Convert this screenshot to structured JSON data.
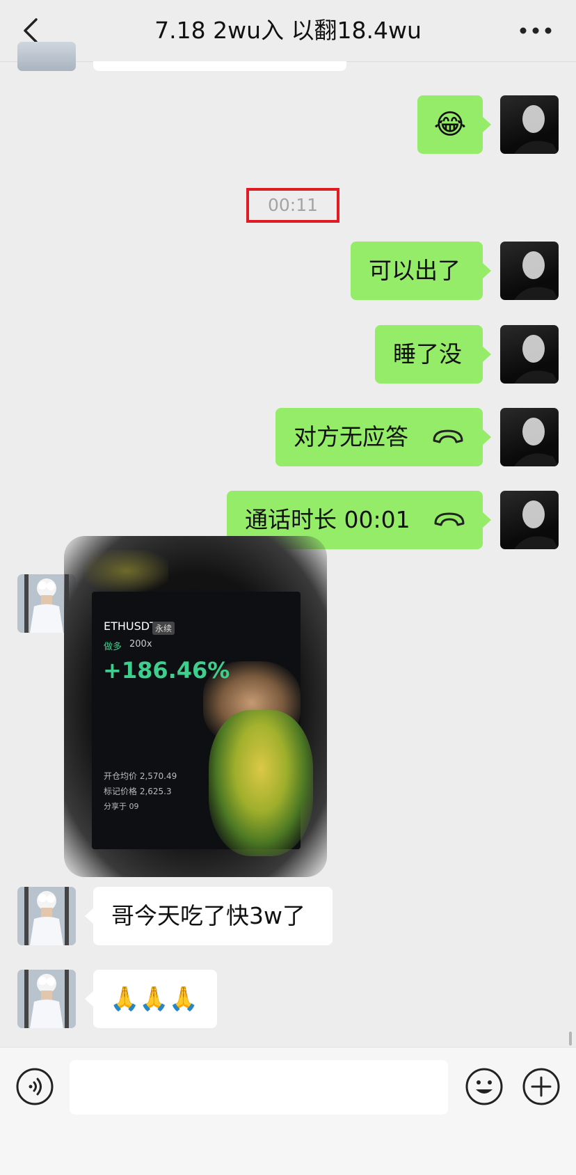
{
  "header": {
    "title": "7.18  2wu入 以翻18.4wu"
  },
  "messages": {
    "time_divider": "00:11",
    "sent": [
      {
        "text": "可以出了"
      },
      {
        "text": "睡了没"
      },
      {
        "text": "对方无应答"
      },
      {
        "text": "通话时长 00:01"
      }
    ],
    "received": [
      {
        "text": "哥今天吃了快3w了"
      },
      {
        "text": "🙏🙏🙏"
      }
    ],
    "emoji_sent": "😂"
  },
  "image_card": {
    "pair": "ETHUSDT",
    "tag": "永续",
    "side": "做多",
    "leverage": "200x",
    "pnl": "+186.46%",
    "open_price": "开仓均价 2,570.49",
    "mark_price": "标记价格 2,625.3",
    "share": "分享于 09"
  },
  "colors": {
    "sent_bubble": "#95ec69",
    "received_bubble": "#ffffff",
    "highlight_box": "#e01b24",
    "pnl_green": "#3ecf8e"
  },
  "icons": {
    "back": "chevron-left-icon",
    "more": "more-dots-icon",
    "call": "hangup-phone-icon",
    "voice": "voice-icon",
    "emoji": "emoji-icon",
    "plus": "plus-icon"
  }
}
